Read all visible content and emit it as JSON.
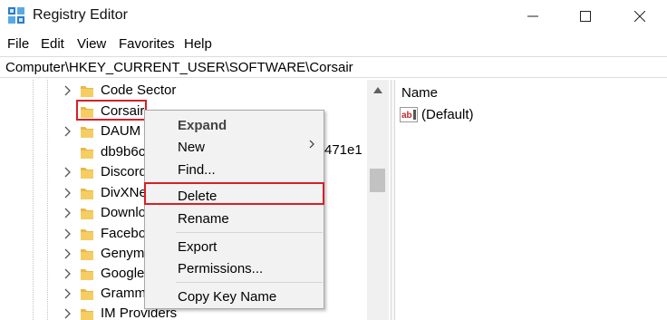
{
  "window": {
    "title": "Registry Editor",
    "icon": "registry-editor-icon"
  },
  "menu": [
    "File",
    "Edit",
    "View",
    "Favorites",
    "Help"
  ],
  "address": "Computer\\HKEY_CURRENT_USER\\SOFTWARE\\Corsair",
  "tree": {
    "items": [
      {
        "label": "Code Sector",
        "expandable": true
      },
      {
        "label": "Corsair",
        "expandable": false,
        "selected": true
      },
      {
        "label": "DAUM",
        "expandable": true
      },
      {
        "label": "db9b6c",
        "expandable": false
      },
      {
        "label": "Discord",
        "expandable": true
      },
      {
        "label": "DivXNe",
        "expandable": true
      },
      {
        "label": "Downlo",
        "expandable": true
      },
      {
        "label": "Facebo",
        "expandable": true
      },
      {
        "label": "Genym",
        "expandable": true
      },
      {
        "label": "Google",
        "expandable": true
      },
      {
        "label": "Gramm",
        "expandable": true
      },
      {
        "label": "IM Providers",
        "expandable": true
      }
    ],
    "truncated_suffix": "471e1"
  },
  "list": {
    "column_name": "Name",
    "values": [
      {
        "name": "(Default)",
        "icon": "string-value-icon"
      }
    ]
  },
  "context_menu": {
    "items": [
      "Expand",
      "New",
      "Find...",
      "Delete",
      "Rename",
      "Export",
      "Permissions...",
      "Copy Key Name"
    ],
    "highlighted": "Delete"
  },
  "colors": {
    "highlight_border": "#d81e26",
    "folder": "#e8b848",
    "menu_bg": "#f2f2f2"
  }
}
